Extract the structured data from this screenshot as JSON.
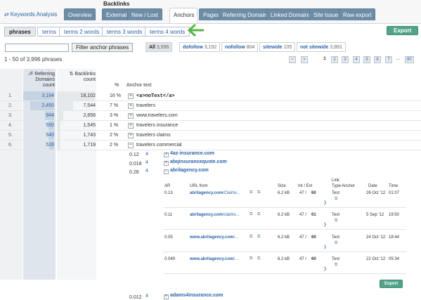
{
  "nav": {
    "section_label": "Backlinks",
    "keywords_link": "Keywords Analysis",
    "tabs": [
      "Overview",
      "External",
      "New / Lost",
      "Anchors",
      "Pages",
      "Referring Domains",
      "Linked Domains",
      "Site Issues",
      "Raw export"
    ]
  },
  "subtabs": [
    "phrases",
    "terms",
    "terms 2 words",
    "terms 3 words",
    "terms 4 words"
  ],
  "export_label": "Export",
  "filter": {
    "button": "Filter anchor phrases"
  },
  "segments": [
    {
      "label": "All",
      "count": "3,996"
    },
    {
      "label": "dofollow",
      "count": "3,192"
    },
    {
      "label": "nofollow",
      "count": "804"
    },
    {
      "label": "sitewide",
      "count": "105"
    },
    {
      "label": "not sitewide",
      "count": "3,891"
    }
  ],
  "results_text": "1 - 50 of 3,996 phrases",
  "pagination": {
    "prev": "<",
    "next": ">",
    "pages": [
      "1",
      "2",
      "3",
      "4",
      "5",
      "6",
      "7"
    ],
    "ellipsis": "...",
    "last": "80"
  },
  "table": {
    "headers": {
      "rd_line1": "↓F Referring",
      "rd_line2": "Domains",
      "rd_line3": "count",
      "bl_line1": "⇅ Backlinks",
      "bl_line2": "count",
      "pct": "%",
      "anchor": "Anchor text"
    },
    "rows": [
      {
        "idx": "1.",
        "rd": "3,164",
        "bl": "18,102",
        "pct": "16 %",
        "anchor": "<a>noText</a>"
      },
      {
        "idx": "2.",
        "rd": "2,450",
        "bl": "7,544",
        "pct": "7 %",
        "anchor": "travelers"
      },
      {
        "idx": "3.",
        "rd": "944",
        "bl": "2,856",
        "pct": "3 %",
        "anchor": "www.travelers.com"
      },
      {
        "idx": "4.",
        "rd": "550",
        "bl": "1,545",
        "pct": "1 %",
        "anchor": "travelers insurance"
      },
      {
        "idx": "5.",
        "rd": "540",
        "bl": "1,743",
        "pct": "2 %",
        "anchor": "travelers claims"
      },
      {
        "idx": "6.",
        "rd": "528",
        "bl": "1,719",
        "pct": "2 %",
        "anchor": "travelers commercial"
      }
    ]
  },
  "domains": [
    {
      "ar": "0.12",
      "count": "4",
      "name": "4az-insurance.com"
    },
    {
      "ar": "0.018",
      "count": "4",
      "name": "abqinsurancequote.com"
    },
    {
      "ar": "0.28",
      "count": "4",
      "name": "abrilagency.com"
    },
    {
      "ar": "0.012",
      "count": "4",
      "name": "adams4insurance.com"
    }
  ],
  "inner": {
    "headers": {
      "ar": "AR",
      "url": "URL from",
      "size": "Size",
      "int_ext": "Int / Ext",
      "link_type": "Link Type",
      "anchor": "Anchor",
      "date": "Date",
      "time": "Time"
    },
    "rows": [
      {
        "ar": "0.13",
        "url_host": "abrilagency.com",
        "url_path": "/Claims...",
        "size": "6.2 kB",
        "int": "47 /",
        "ext": "60",
        "type": "Text",
        "date": "26 Oct '12",
        "time": "01:07"
      },
      {
        "ar": "0.11",
        "url_host": "abrilagency.com",
        "url_path": "/claims...",
        "size": "6.2 kB",
        "int": "47 /",
        "ext": "61",
        "type": "Text",
        "date": "5 Sep '12",
        "time": "19:50"
      },
      {
        "ar": "0.05",
        "url_host": "www.abrilagency.com",
        "url_path": "/...",
        "size": "6.2 kB",
        "int": "47 /",
        "ext": "60",
        "type": "Text",
        "date": "24 Oct '12",
        "time": "18:44"
      },
      {
        "ar": "0.049",
        "url_host": "www.abrilagency.com",
        "url_path": "/...",
        "size": "6.2 kB",
        "int": "47 /",
        "ext": "60",
        "type": "Text",
        "date": "22 Oct '12",
        "time": "05:34"
      }
    ],
    "export": "Export"
  }
}
